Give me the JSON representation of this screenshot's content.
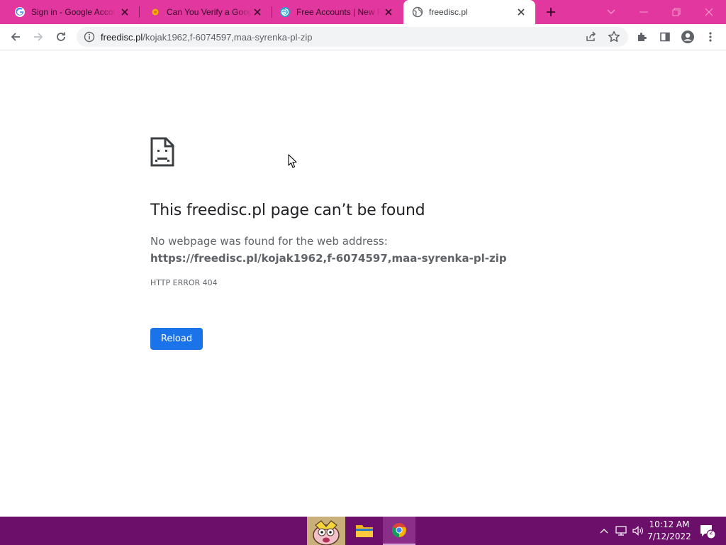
{
  "browser": {
    "tabs": [
      {
        "title": "Sign in - Google Accounts",
        "favicon": "google-g-icon",
        "active": false
      },
      {
        "title": "Can You Verify a Google Account",
        "favicon": "yellow-dot-icon",
        "active": false
      },
      {
        "title": "Free Accounts | New Free",
        "favicon": "spiral-icon",
        "active": false
      },
      {
        "title": "freedisc.pl",
        "favicon": "globe-icon",
        "active": true
      }
    ],
    "address_bar": {
      "host": "freedisc.pl",
      "path": "/kojak1962,f-6074597,maa-syrenka-pl-zip"
    }
  },
  "error_page": {
    "heading": "This freedisc.pl page can’t be found",
    "description_prefix": "No webpage was found for the web address: ",
    "description_url": "https://freedisc.pl/kojak1962,f-6074597,maa-syrenka-pl-zip",
    "error_code": "HTTP ERROR 404",
    "reload_label": "Reload"
  },
  "taskbar": {
    "time": "10:12 AM",
    "date": "7/12/2022",
    "notification_count": "2"
  },
  "colors": {
    "tab_strip": "#e2379e",
    "taskbar": "#6b0f6b",
    "reload_button": "#1a73e8"
  }
}
